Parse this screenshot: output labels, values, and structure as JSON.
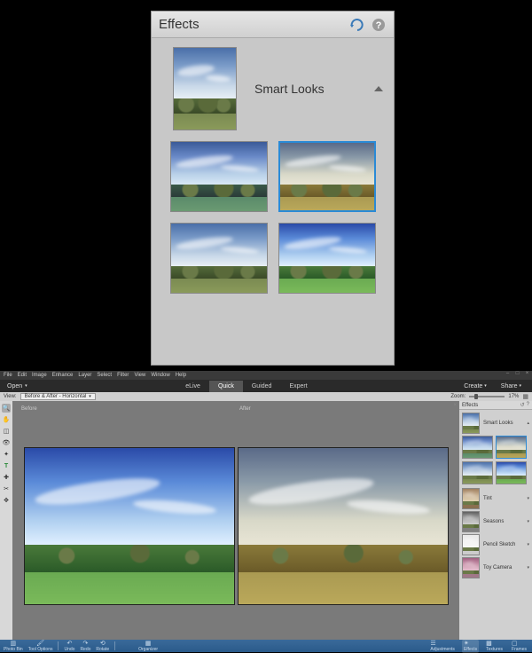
{
  "effects_panel": {
    "title": "Effects",
    "category_label": "Smart Looks"
  },
  "app": {
    "menu": [
      "File",
      "Edit",
      "Image",
      "Enhance",
      "Layer",
      "Select",
      "Filter",
      "View",
      "Window",
      "Help"
    ],
    "open_label": "Open",
    "modes": [
      "eLive",
      "Quick",
      "Guided",
      "Expert"
    ],
    "active_mode": "Quick",
    "create_label": "Create",
    "share_label": "Share",
    "view_label": "View:",
    "view_value": "Before & After - Horizontal",
    "zoom_label": "Zoom:",
    "zoom_value": "17%",
    "before_label": "Before",
    "after_label": "After",
    "right_panel": {
      "title": "Effects",
      "categories": [
        {
          "label": "Smart Looks",
          "expanded": true
        },
        {
          "label": "Tint",
          "expanded": false
        },
        {
          "label": "Seasons",
          "expanded": false
        },
        {
          "label": "Pencil Sketch",
          "expanded": false
        },
        {
          "label": "Toy Camera",
          "expanded": false
        }
      ]
    },
    "statusbar": {
      "items": [
        "Photo Bin",
        "Tool Options",
        "Undo",
        "Redo",
        "Rotate",
        "Organizer"
      ],
      "right_tabs": [
        "Adjustments",
        "Effects",
        "Textures",
        "Frames"
      ],
      "active_right_tab": "Effects"
    }
  }
}
